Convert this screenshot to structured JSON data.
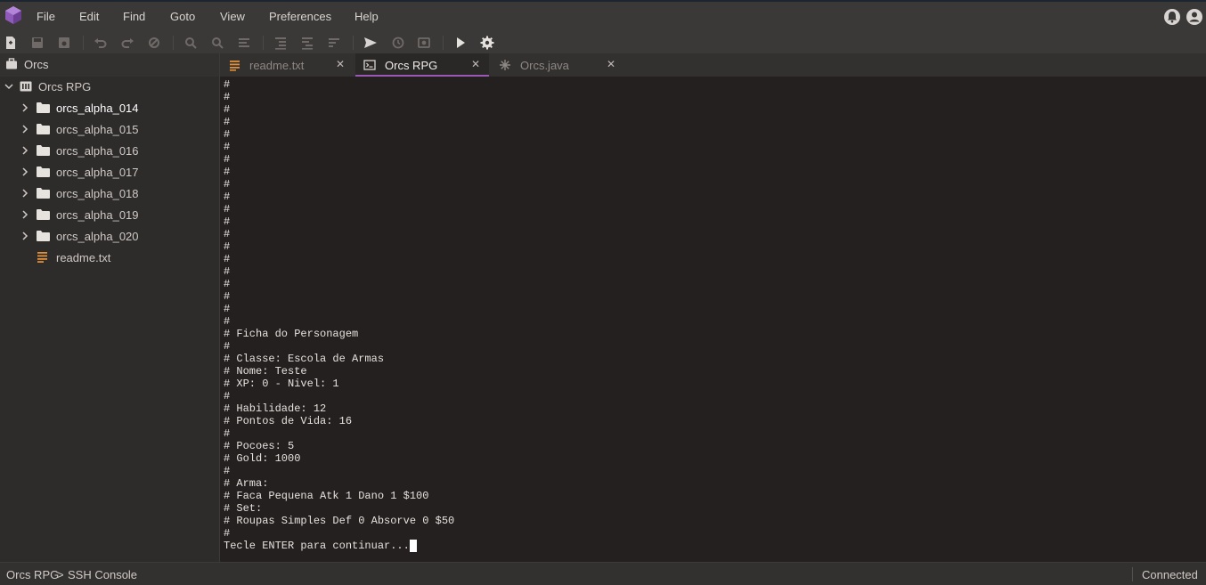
{
  "menu": {
    "items": [
      "File",
      "Edit",
      "Find",
      "Goto",
      "View",
      "Preferences",
      "Help"
    ]
  },
  "topbar_icons": [
    "notifications-icon",
    "account-icon"
  ],
  "toolbar": {
    "icons": [
      "new-file-icon",
      "save-icon",
      "save-all-icon",
      "undo-icon",
      "redo-icon",
      "revert-icon",
      "find-icon",
      "find-next-icon",
      "replace-icon",
      "indent-icon",
      "outdent-icon",
      "sort-icon",
      "send-icon",
      "history-icon",
      "screenshot-icon",
      "run-icon",
      "settings-icon"
    ]
  },
  "sidebar": {
    "header": "Orcs",
    "project": "Orcs RPG",
    "items": [
      {
        "label": "orcs_alpha_014",
        "type": "folder"
      },
      {
        "label": "orcs_alpha_015",
        "type": "folder"
      },
      {
        "label": "orcs_alpha_016",
        "type": "folder"
      },
      {
        "label": "orcs_alpha_017",
        "type": "folder"
      },
      {
        "label": "orcs_alpha_018",
        "type": "folder"
      },
      {
        "label": "orcs_alpha_019",
        "type": "folder"
      },
      {
        "label": "orcs_alpha_020",
        "type": "folder"
      },
      {
        "label": "readme.txt",
        "type": "file"
      }
    ]
  },
  "tabs": [
    {
      "label": "readme.txt",
      "icon": "text-file-icon",
      "active": false
    },
    {
      "label": "Orcs RPG",
      "icon": "terminal-icon",
      "active": true
    },
    {
      "label": "Orcs.java",
      "icon": "java-file-icon",
      "active": false
    }
  ],
  "console": {
    "lines": [
      "#",
      "#",
      "#",
      "#",
      "#",
      "#",
      "#",
      "#",
      "#",
      "#",
      "#",
      "#",
      "#",
      "#",
      "#",
      "#",
      "#",
      "#",
      "#",
      "#",
      "# Ficha do Personagem",
      "#",
      "# Classe: Escola de Armas",
      "# Nome: Teste",
      "# XP: 0 - Nivel: 1",
      "#",
      "# Habilidade: 12",
      "# Pontos de Vida: 16",
      "#",
      "# Pocoes: 5",
      "# Gold: 1000",
      "#",
      "# Arma:",
      "# Faca Pequena Atk 1 Dano 1 $100",
      "# Set:",
      "# Roupas Simples Def 0 Absorve 0 $50",
      "#"
    ],
    "prompt": "Tecle ENTER para continuar..."
  },
  "status": {
    "breadcrumb_project": "Orcs RPG",
    "breadcrumb_sep": ">",
    "breadcrumb_view": "SSH Console",
    "connection": "Connected"
  },
  "colors": {
    "accent": "#9b59b6",
    "background": "#2f2c2b",
    "console_bg": "#242020"
  }
}
